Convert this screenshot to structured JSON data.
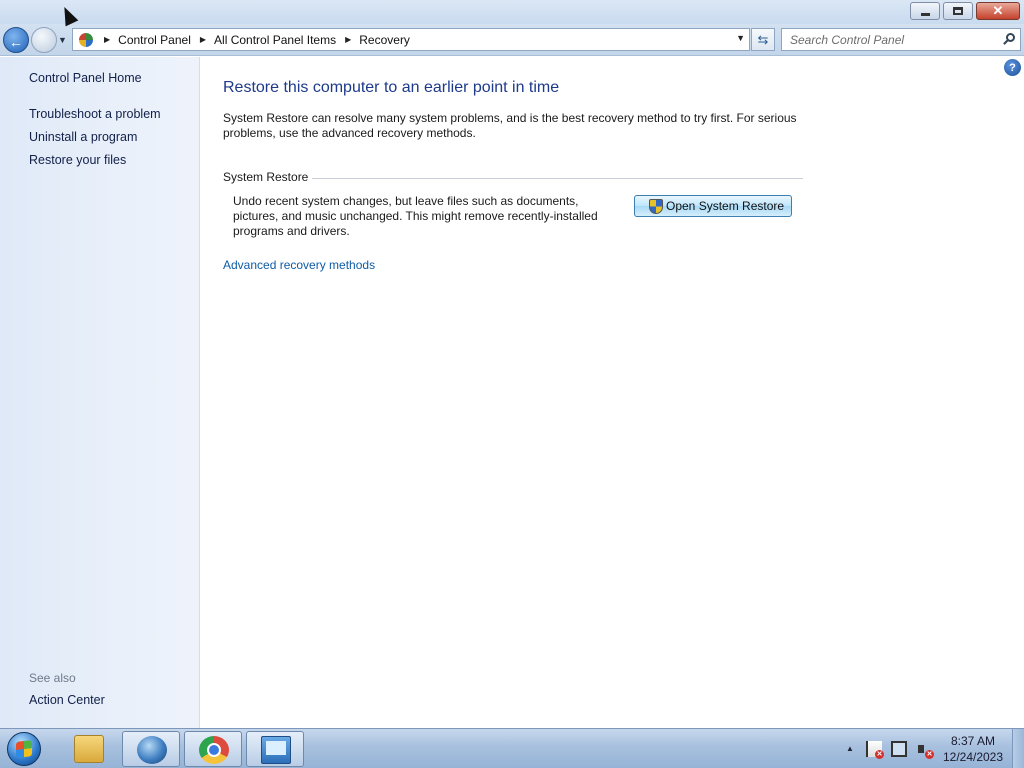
{
  "window": {
    "minimize_glyph": "",
    "close_glyph": "✕"
  },
  "address_bar": {
    "crumbs": [
      "Control Panel",
      "All Control Panel Items",
      "Recovery"
    ]
  },
  "search": {
    "placeholder": "Search Control Panel"
  },
  "sidebar": {
    "items": [
      {
        "label": "Control Panel Home"
      },
      {
        "label": "Troubleshoot a problem"
      },
      {
        "label": "Uninstall a program"
      },
      {
        "label": "Restore your files"
      }
    ],
    "see_also_label": "See also",
    "see_also_items": [
      {
        "label": "Action Center"
      }
    ]
  },
  "main": {
    "help_glyph": "?",
    "title": "Restore this computer to an earlier point in time",
    "intro": "System Restore can resolve many system problems, and is the best recovery method to try first. For serious problems, use the advanced recovery methods.",
    "section_title": "System Restore",
    "section_desc": "Undo recent system changes, but leave files such as documents, pictures, and music unchanged. This might remove recently-installed programs and drivers.",
    "open_button_label": "Open System Restore",
    "advanced_link": "Advanced recovery methods"
  },
  "taskbar": {
    "items": [
      "windows-explorer",
      "system-restore-app",
      "google-chrome",
      "control-panel"
    ],
    "active_item": "control-panel"
  },
  "clock": {
    "time": "8:37 AM",
    "date": "12/24/2023"
  }
}
